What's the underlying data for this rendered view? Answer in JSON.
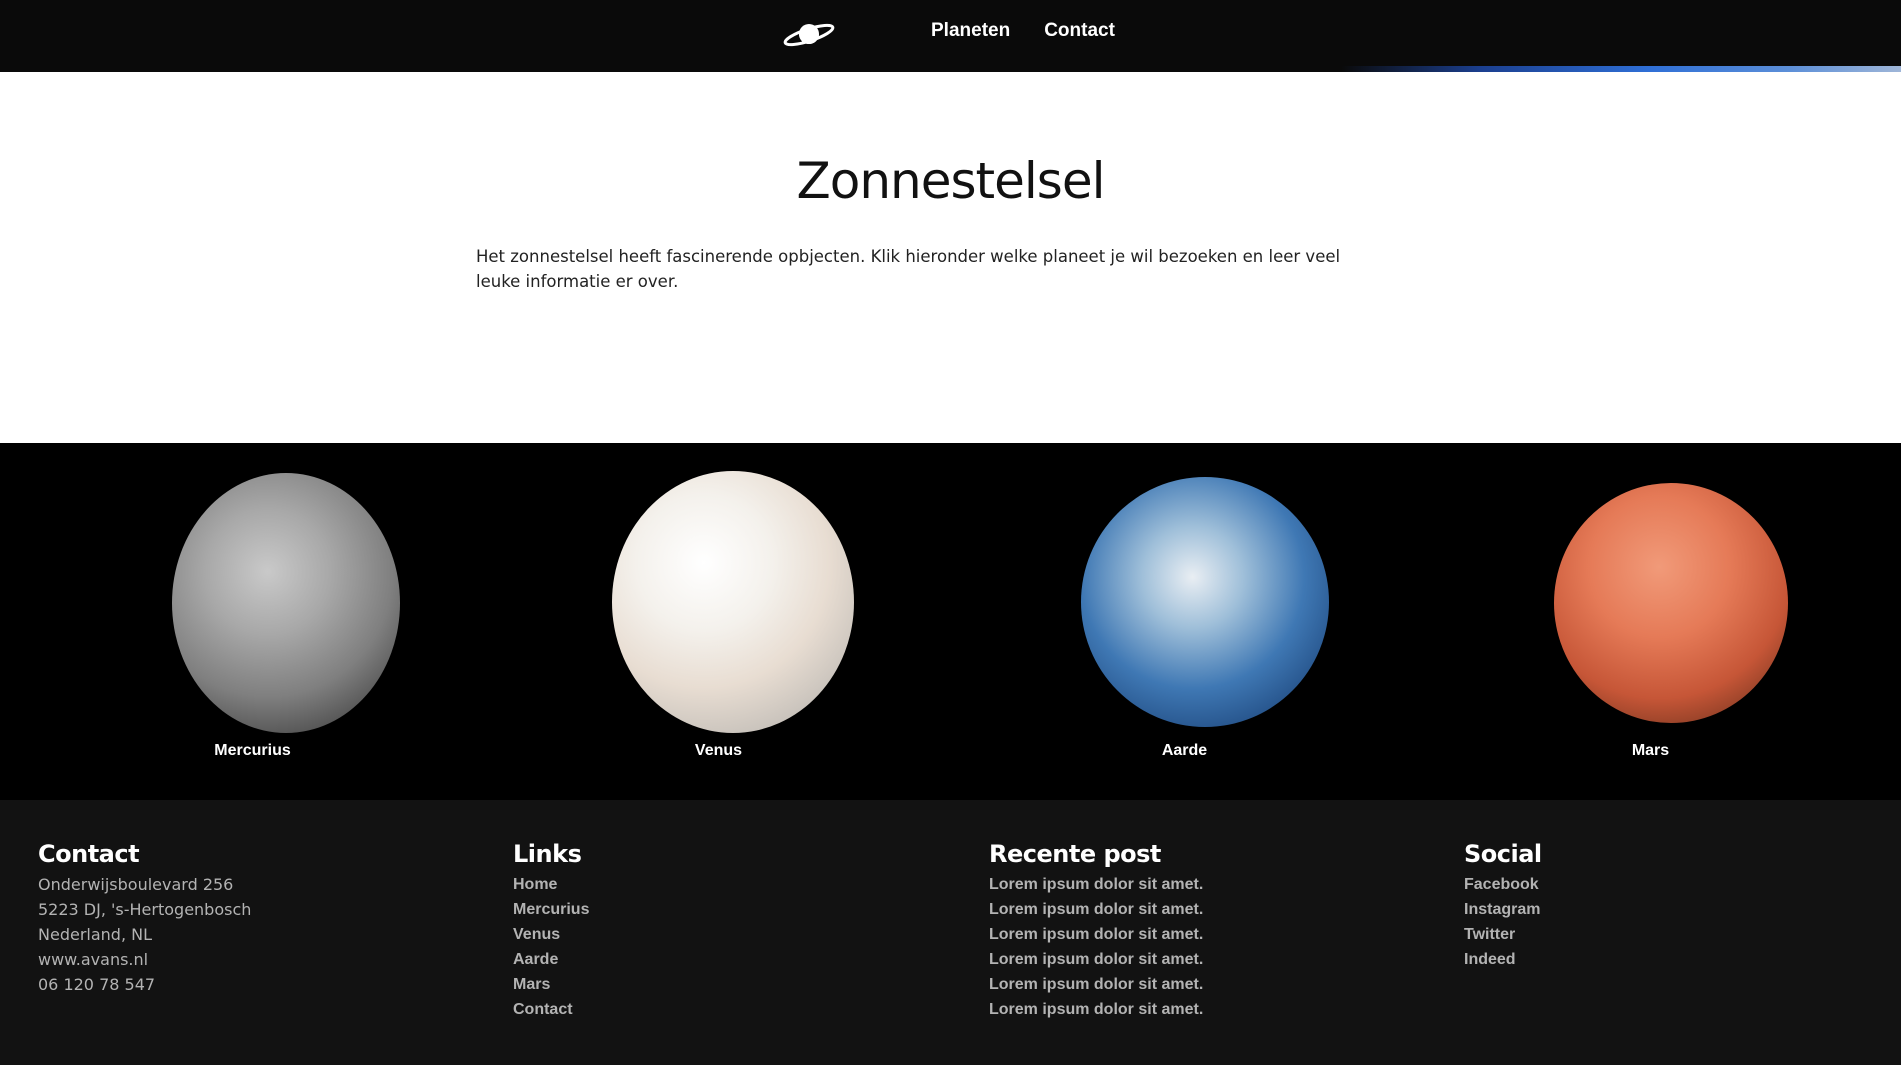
{
  "header": {
    "logo_icon": "saturn-planet-icon",
    "nav": [
      {
        "label": "Planeten"
      },
      {
        "label": "Contact"
      }
    ]
  },
  "intro": {
    "title": "Zonnestelsel",
    "text": "Het zonnestelsel heeft fascinerende opbjecten. Klik hieronder welke planeet je wil bezoeken en leer veel leuke informatie er over."
  },
  "planets": [
    {
      "name": "Mercurius",
      "color": "#8a8a8a"
    },
    {
      "name": "Venus",
      "color": "#eee6dc"
    },
    {
      "name": "Aarde",
      "color": "#3f78b4"
    },
    {
      "name": "Mars",
      "color": "#e57a57"
    }
  ],
  "footer": {
    "contact": {
      "title": "Contact",
      "lines": [
        "Onderwijsboulevard 256",
        "5223 DJ, 's-Hertogenbosch",
        "Nederland, NL",
        "www.avans.nl",
        "06 120 78 547"
      ]
    },
    "links": {
      "title": "Links",
      "items": [
        "Home",
        "Mercurius",
        "Venus",
        "Aarde",
        "Mars",
        "Contact"
      ]
    },
    "recent": {
      "title": "Recente post",
      "items": [
        "Lorem ipsum dolor sit amet.",
        "Lorem ipsum dolor sit amet.",
        "Lorem ipsum dolor sit amet.",
        "Lorem ipsum dolor sit amet.",
        "Lorem ipsum dolor sit amet.",
        "Lorem ipsum dolor sit amet."
      ]
    },
    "social": {
      "title": "Social",
      "items": [
        "Facebook",
        "Instagram",
        "Twitter",
        "Indeed"
      ]
    }
  },
  "colors": {
    "header_bg": "#0a0a0a",
    "planets_bg": "#000000",
    "footer_bg": "#121212",
    "footer_text": "#b3b3b3"
  }
}
